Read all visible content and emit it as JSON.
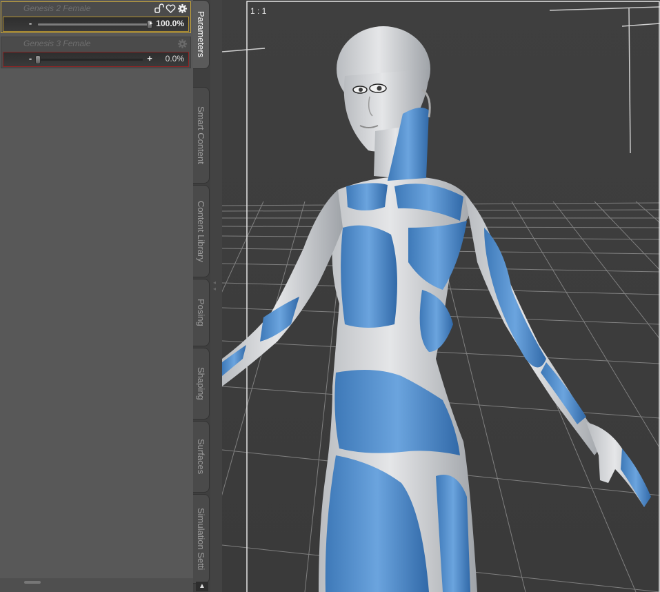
{
  "parameters": [
    {
      "name": "Genesis 2 Female",
      "value_text": "100.0%",
      "value": 1.0,
      "state": "active",
      "icons": [
        "chain-link-icon",
        "heart-icon",
        "gear-icon"
      ]
    },
    {
      "name": "Genesis 3 Female",
      "value_text": "0.0%",
      "value": 0.0,
      "state": "inactive",
      "icons": [
        "gear-icon"
      ]
    }
  ],
  "slider_buttons": {
    "minus": "-",
    "plus": "+"
  },
  "tabs": [
    {
      "label": "Parameters",
      "selected": true
    },
    {
      "label": "Smart Content",
      "selected": false
    },
    {
      "label": "Content Library",
      "selected": false
    },
    {
      "label": "Posing",
      "selected": false
    },
    {
      "label": "Shaping",
      "selected": false
    },
    {
      "label": "Surfaces",
      "selected": false
    },
    {
      "label": "Simulation Setti",
      "selected": false
    }
  ],
  "viewport": {
    "aspect_label": "1 : 1",
    "colors": {
      "skin": "#d9dadc",
      "morph_highlight": "#4a86c8",
      "grid": "#9a9a9a",
      "frame": "#e8e8e8",
      "background": "#3d3d3d"
    }
  },
  "scroll": {
    "up_arrow": "▲"
  }
}
